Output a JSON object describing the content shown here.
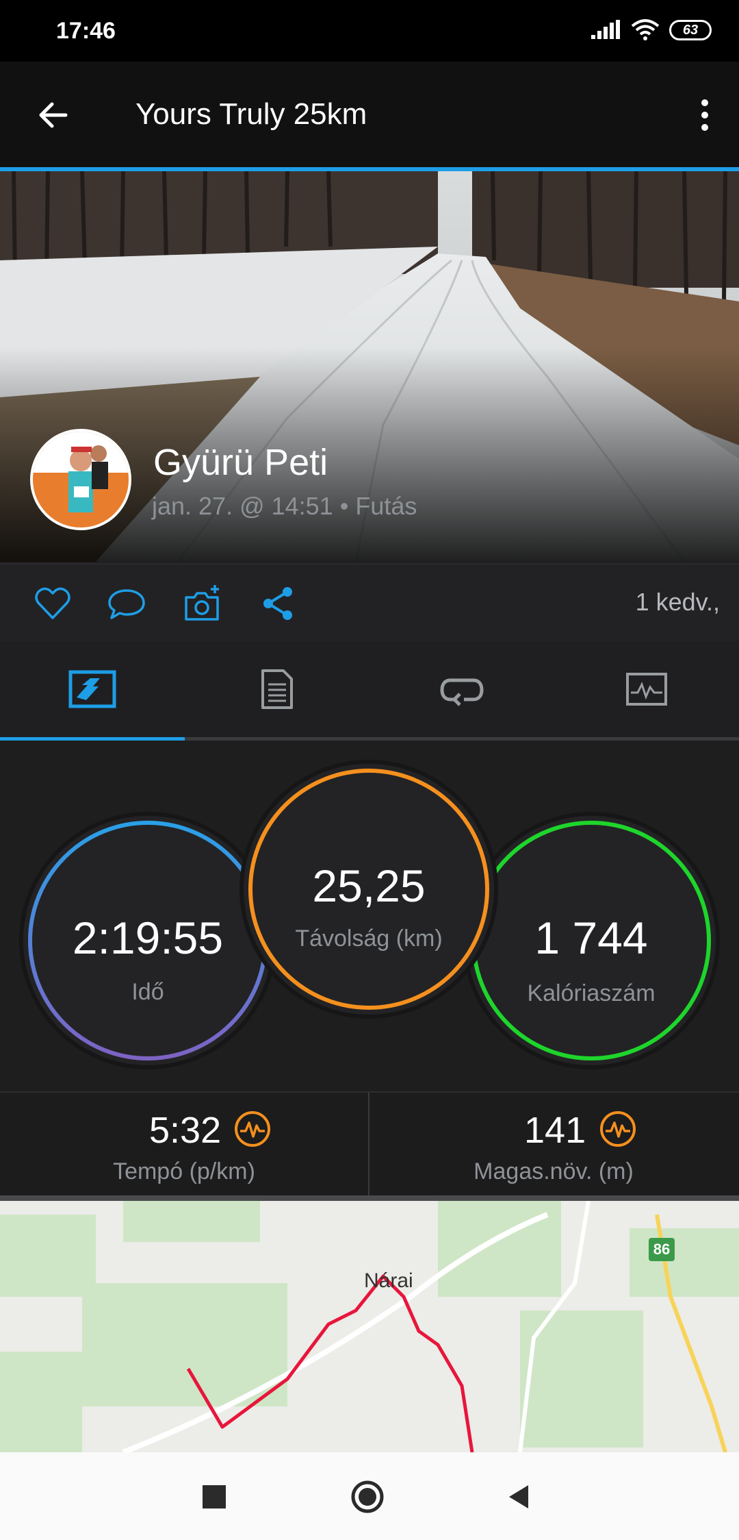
{
  "status_bar": {
    "time": "17:46",
    "battery": "63"
  },
  "app_bar": {
    "title": "Yours Truly 25km"
  },
  "activity": {
    "user_name": "Gyürü Peti",
    "meta": "jan. 27. @ 14:51 • Futás"
  },
  "actions": {
    "likes": "1 kedv.,"
  },
  "tabs": [
    {
      "icon": "overview-chart-icon",
      "active": true
    },
    {
      "icon": "details-document-icon",
      "active": false
    },
    {
      "icon": "laps-loop-icon",
      "active": false
    },
    {
      "icon": "graph-icon",
      "active": false
    }
  ],
  "stats": {
    "time": {
      "value": "2:19:55",
      "label": "Idő"
    },
    "distance": {
      "value": "25,25",
      "label": "Távolság (km)"
    },
    "calories": {
      "value": "1 744",
      "label": "Kalóriaszám"
    }
  },
  "sub_stats": {
    "pace": {
      "value": "5:32",
      "label": "Tempó (p/km)"
    },
    "elevation": {
      "value": "141",
      "label": "Magas.növ. (m)"
    }
  },
  "map": {
    "place_label": "Nárai",
    "road_number": "86"
  },
  "colors": {
    "accent": "#1e9ee6",
    "distance_ring": "#f5901e",
    "calories_ring": "#1ed52b",
    "time_ring_top": "#2aa0e8",
    "time_ring_bottom": "#7e63c4",
    "route": "#e8163c"
  }
}
